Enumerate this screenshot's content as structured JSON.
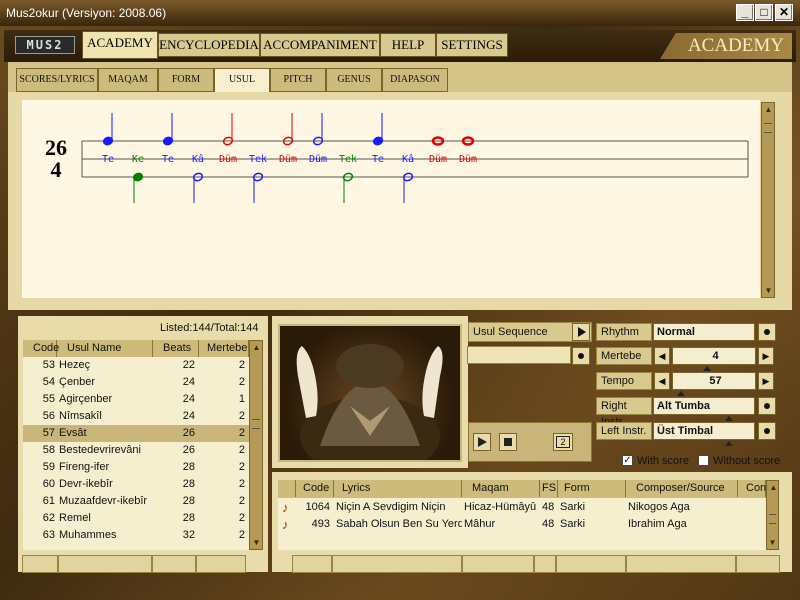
{
  "window": {
    "title": "Mus2okur  (Versiyon: 2008.06)",
    "min": "_",
    "max": "□",
    "close": "✕"
  },
  "logo": "MUS2",
  "main_tabs": [
    "ACADEMY",
    "ENCYCLOPEDIA",
    "ACCOMPANIMENT",
    "HELP",
    "SETTINGS"
  ],
  "banner": "ACADEMY",
  "sub_tabs": [
    "SCORES/LYRICS",
    "MAQAM",
    "FORM",
    "USUL",
    "PITCH",
    "GENUS",
    "DIAPASON"
  ],
  "notation": {
    "time_top": "26",
    "time_bottom": "4",
    "strokes": [
      {
        "syl": "Te",
        "color": "#1a1aff",
        "dir": "up",
        "filled": true
      },
      {
        "syl": "Ke",
        "color": "#008000",
        "dir": "down",
        "filled": true
      },
      {
        "syl": "Te",
        "color": "#1a1aff",
        "dir": "up",
        "filled": true
      },
      {
        "syl": "Kâ",
        "color": "#1a1aff",
        "dir": "down",
        "filled": false
      },
      {
        "syl": "Düm",
        "color": "#e00000",
        "dir": "up",
        "filled": false
      },
      {
        "syl": "Tek",
        "color": "#1a1aff",
        "dir": "down",
        "filled": false
      },
      {
        "syl": "Düm",
        "color": "#e00000",
        "dir": "up",
        "filled": false
      },
      {
        "syl": "Düm",
        "color": "#1a1aff",
        "dir": "up",
        "filled": false
      },
      {
        "syl": "Tek",
        "color": "#008000",
        "dir": "down",
        "filled": false
      },
      {
        "syl": "Te",
        "color": "#1a1aff",
        "dir": "up",
        "filled": true
      },
      {
        "syl": "Kâ",
        "color": "#1a1aff",
        "dir": "down",
        "filled": false
      },
      {
        "syl": "Düm",
        "color": "#e00000",
        "dir": "whole",
        "filled": false
      },
      {
        "syl": "Düm",
        "color": "#e00000",
        "dir": "whole",
        "filled": false
      }
    ]
  },
  "usul_list": {
    "listed": "Listed:144/Total:144",
    "headers": [
      "Code",
      "Usul Name",
      "Beats",
      "Mertebe"
    ],
    "rows": [
      {
        "code": "53",
        "name": "Hezeç",
        "beats": "22",
        "mertebe": "2"
      },
      {
        "code": "54",
        "name": "Çenber",
        "beats": "24",
        "mertebe": "2"
      },
      {
        "code": "55",
        "name": "Agirçenber",
        "beats": "24",
        "mertebe": "1"
      },
      {
        "code": "56",
        "name": "Nîmsakîl",
        "beats": "24",
        "mertebe": "2"
      },
      {
        "code": "57",
        "name": "Evsât",
        "beats": "26",
        "mertebe": "2"
      },
      {
        "code": "58",
        "name": "Bestedevrirevâni",
        "beats": "26",
        "mertebe": "2"
      },
      {
        "code": "59",
        "name": "Fireng-ifer",
        "beats": "28",
        "mertebe": "2"
      },
      {
        "code": "60",
        "name": "Devr-ikebîr",
        "beats": "28",
        "mertebe": "2"
      },
      {
        "code": "61",
        "name": "Muzaafdevr-ikebîr",
        "beats": "28",
        "mertebe": "2"
      },
      {
        "code": "62",
        "name": "Remel",
        "beats": "28",
        "mertebe": "2"
      },
      {
        "code": "63",
        "name": "Muhammes",
        "beats": "32",
        "mertebe": "2"
      }
    ],
    "selected_index": 4
  },
  "controls": {
    "usul_sequence": "Usul Sequence",
    "rhythm_label": "Rhythm",
    "rhythm_value": "Normal",
    "mertebe_label": "Mertebe",
    "mertebe_value": "4",
    "tempo_label": "Tempo",
    "tempo_value": "57",
    "right_label": "Right Instr.",
    "right_value": "Alt Tumba",
    "left_label": "Left Instr.",
    "left_value": "Üst Timbal",
    "with_score": "With score",
    "without_score": "Without score",
    "loop_badge": "2"
  },
  "scores": {
    "headers": [
      "Code",
      "Lyrics",
      "Maqam",
      "FS",
      "Form",
      "Composer/Source",
      "Con"
    ],
    "rows": [
      {
        "code": "1064",
        "lyrics": "Niçin A Sevdigim Niçin",
        "maqam": "Hicaz-Hümâyû",
        "fs": "48",
        "form": "Sarki",
        "composer": "Nikogos Aga"
      },
      {
        "code": "493",
        "lyrics": "Sabah Olsun Ben Su Yerde",
        "maqam": "Mâhur",
        "fs": "48",
        "form": "Sarki",
        "composer": "Ibrahim Aga"
      }
    ]
  }
}
